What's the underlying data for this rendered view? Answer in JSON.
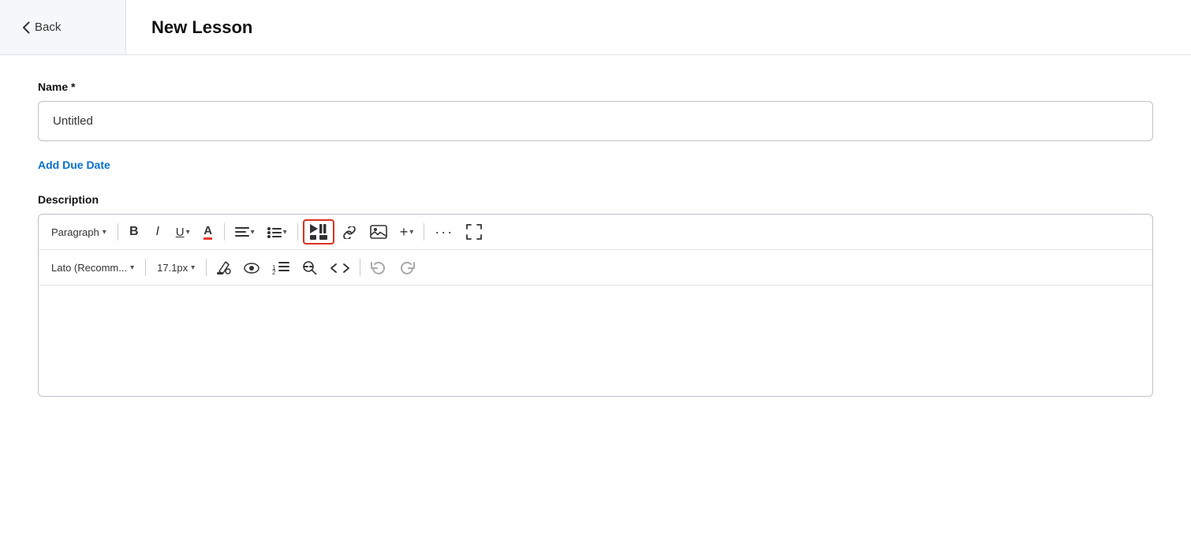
{
  "header": {
    "back_label": "Back",
    "title": "New Lesson"
  },
  "form": {
    "name_label": "Name *",
    "name_value": "Untitled",
    "add_due_date_label": "Add Due Date",
    "description_label": "Description"
  },
  "toolbar_row1": {
    "paragraph_label": "Paragraph",
    "bold_label": "B",
    "italic_label": "I",
    "underline_label": "U",
    "text_color_label": "A",
    "align_label": "≡",
    "list_label": "≡",
    "media_label": "▶‖",
    "link_label": "🔗",
    "image_label": "🖼",
    "add_label": "+",
    "more_label": "···",
    "fullscreen_label": "⤢"
  },
  "toolbar_row2": {
    "font_label": "Lato (Recomm...",
    "size_label": "17.1px",
    "paint_label": "🪣",
    "eye_label": "👁",
    "list_numbered_label": "≡₁₂₃",
    "search_replace_label": "🔍",
    "code_label": "</>",
    "undo_label": "↺",
    "redo_label": "↻"
  }
}
